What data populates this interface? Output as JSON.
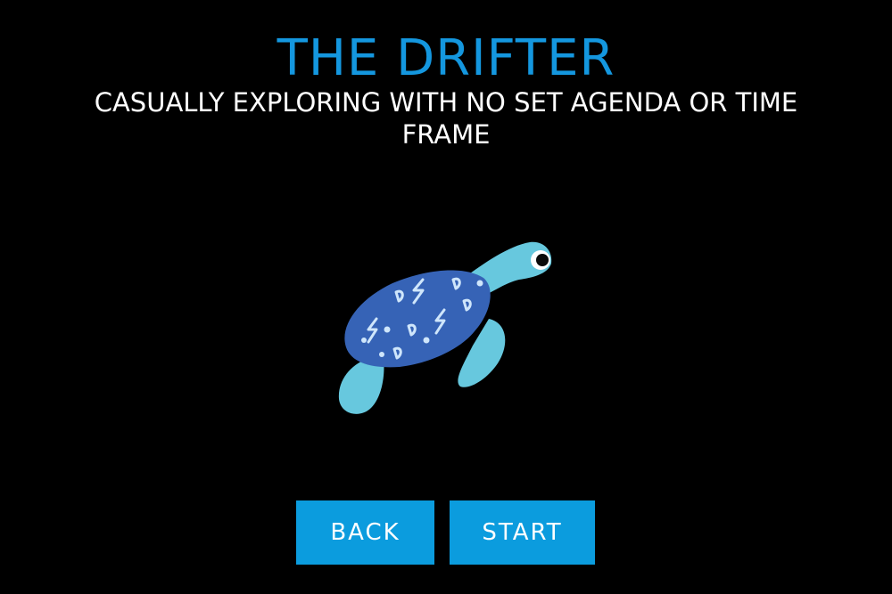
{
  "screen": {
    "title": "THE DRIFTER",
    "subtitle": "CASUALLY EXPLORING WITH NO SET AGENDA OR TIME FRAME",
    "illustration_icon": "sea-turtle-icon"
  },
  "buttons": {
    "back_label": "BACK",
    "start_label": "START"
  },
  "colors": {
    "background": "#000000",
    "title": "#1497df",
    "subtitle": "#ffffff",
    "button": "#0b9cde",
    "turtle_shell": "#3663b6",
    "turtle_skin": "#67c8de"
  }
}
